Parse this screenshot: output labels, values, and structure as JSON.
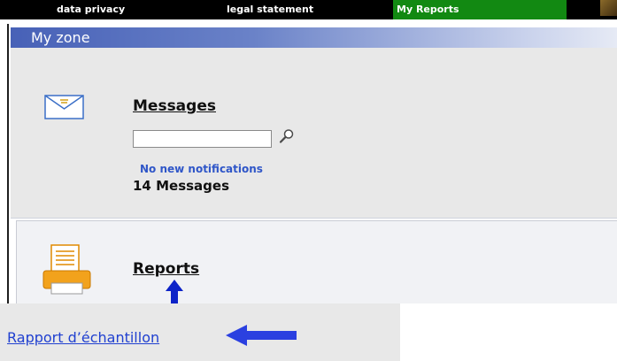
{
  "topnav": {
    "data_privacy": "data privacy",
    "legal_statement": "legal statement",
    "my_reports": "My Reports"
  },
  "zone": {
    "title": "My zone"
  },
  "messages": {
    "title": "Messages",
    "search_value": "",
    "search_icon": "search-icon",
    "notification": "No new notifications",
    "count": "14 Messages"
  },
  "reports": {
    "title": "Reports"
  },
  "callout": {
    "link": "Rapport d’échantillon"
  },
  "colors": {
    "accent_blue": "#4761b7",
    "nav_green": "#128912",
    "link_blue": "#2040d0",
    "annotation_arrow": "#2b40e0"
  }
}
